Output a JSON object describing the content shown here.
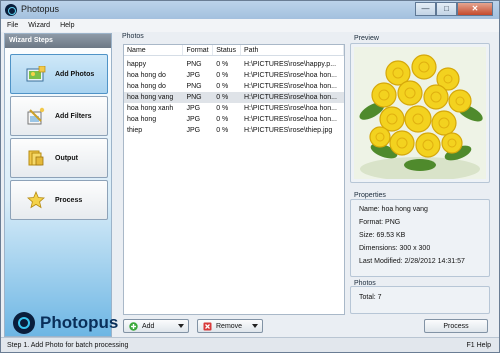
{
  "window": {
    "title": "Photopus"
  },
  "menu": [
    "File",
    "Wizard",
    "Help"
  ],
  "sidebar": {
    "header": "Wizard Steps",
    "steps": [
      {
        "label": "Add Photos",
        "icon": "add-photos-icon",
        "active": true
      },
      {
        "label": "Add Filters",
        "icon": "add-filters-icon",
        "active": false
      },
      {
        "label": "Output",
        "icon": "output-folder-icon",
        "active": false
      },
      {
        "label": "Process",
        "icon": "star-icon",
        "active": false
      }
    ],
    "logo_text": "Photopus"
  },
  "photos": {
    "group_title": "Photos",
    "columns": [
      "Name",
      "Format",
      "Status",
      "Path"
    ],
    "rows": [
      {
        "name": "happy",
        "format": "PNG",
        "status": "0 %",
        "path": "H:\\PICTURES\\rose\\happy.p..."
      },
      {
        "name": "hoa hong do",
        "format": "JPG",
        "status": "0 %",
        "path": "H:\\PICTURES\\rose\\hoa hon..."
      },
      {
        "name": "hoa hong do",
        "format": "PNG",
        "status": "0 %",
        "path": "H:\\PICTURES\\rose\\hoa hon..."
      },
      {
        "name": "hoa hong vang",
        "format": "PNG",
        "status": "0 %",
        "path": "H:\\PICTURES\\rose\\hoa hon..."
      },
      {
        "name": "hoa hong xanh",
        "format": "JPG",
        "status": "0 %",
        "path": "H:\\PICTURES\\rose\\hoa hon..."
      },
      {
        "name": "hoa hong",
        "format": "JPG",
        "status": "0 %",
        "path": "H:\\PICTURES\\rose\\hoa hon..."
      },
      {
        "name": "thiep",
        "format": "JPG",
        "status": "0 %",
        "path": "H:\\PICTURES\\rose\\thiep.jpg"
      }
    ],
    "selected_index": 3,
    "add_label": "Add",
    "remove_label": "Remove"
  },
  "preview": {
    "title": "Preview"
  },
  "properties": {
    "title": "Properties",
    "lines": [
      "Name: hoa hong vang",
      "Format: PNG",
      "Size: 69.53 KB",
      "Dimensions: 300 x 300",
      "Last Modified: 2/28/2012 14:31:57"
    ]
  },
  "photos_summary": {
    "title": "Photos",
    "total": "Total: 7"
  },
  "process_label": "Process",
  "status": {
    "left": "Step 1. Add Photo for batch processing",
    "right": "F1 Help"
  },
  "colors": {
    "accent": "#4f93c7",
    "selection": "#dfe3e8",
    "close": "#c44a2e"
  }
}
